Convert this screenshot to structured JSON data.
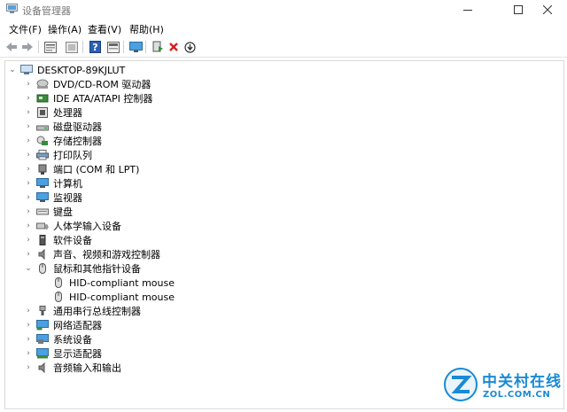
{
  "window": {
    "title": "设备管理器"
  },
  "menu": [
    "文件(F)",
    "操作(A)",
    "查看(V)",
    "帮助(H)"
  ],
  "toolbar": {
    "buttons": [
      "back-arrow-icon",
      "forward-arrow-icon",
      "properties-icon",
      "show-hidden-icon",
      "help-icon",
      "device-properties-icon",
      "scan-monitor-icon",
      "update-driver-icon",
      "uninstall-icon",
      "disable-device-icon"
    ]
  },
  "tree": {
    "root": "DESKTOP-89KJLUT",
    "items": [
      {
        "label": "DVD/CD-ROM 驱动器",
        "icon": "dvd-drive-icon",
        "expanded": false
      },
      {
        "label": "IDE ATA/ATAPI 控制器",
        "icon": "ide-controller-icon",
        "expanded": false
      },
      {
        "label": "处理器",
        "icon": "processor-icon",
        "expanded": false
      },
      {
        "label": "磁盘驱动器",
        "icon": "disk-drive-icon",
        "expanded": false
      },
      {
        "label": "存储控制器",
        "icon": "storage-controller-icon",
        "expanded": false
      },
      {
        "label": "打印队列",
        "icon": "printer-icon",
        "expanded": false
      },
      {
        "label": "端口 (COM 和 LPT)",
        "icon": "port-icon",
        "expanded": false
      },
      {
        "label": "计算机",
        "icon": "computer-icon",
        "expanded": false
      },
      {
        "label": "监视器",
        "icon": "monitor-icon",
        "expanded": false
      },
      {
        "label": "键盘",
        "icon": "keyboard-icon",
        "expanded": false
      },
      {
        "label": "人体学输入设备",
        "icon": "hid-icon",
        "expanded": false
      },
      {
        "label": "软件设备",
        "icon": "software-device-icon",
        "expanded": false
      },
      {
        "label": "声音、视频和游戏控制器",
        "icon": "sound-icon",
        "expanded": false
      },
      {
        "label": "鼠标和其他指针设备",
        "icon": "mouse-icon",
        "expanded": true,
        "children": [
          "HID-compliant mouse",
          "HID-compliant mouse"
        ]
      },
      {
        "label": "通用串行总线控制器",
        "icon": "usb-icon",
        "expanded": false
      },
      {
        "label": "网络适配器",
        "icon": "network-adapter-icon",
        "expanded": false
      },
      {
        "label": "系统设备",
        "icon": "system-device-icon",
        "expanded": false
      },
      {
        "label": "显示适配器",
        "icon": "display-adapter-icon",
        "expanded": false
      },
      {
        "label": "音频输入和输出",
        "icon": "audio-io-icon",
        "expanded": false
      }
    ]
  },
  "watermark": {
    "cn": "中关村在线",
    "en": "ZOL.COM.CN",
    "logo": "zol-logo"
  }
}
